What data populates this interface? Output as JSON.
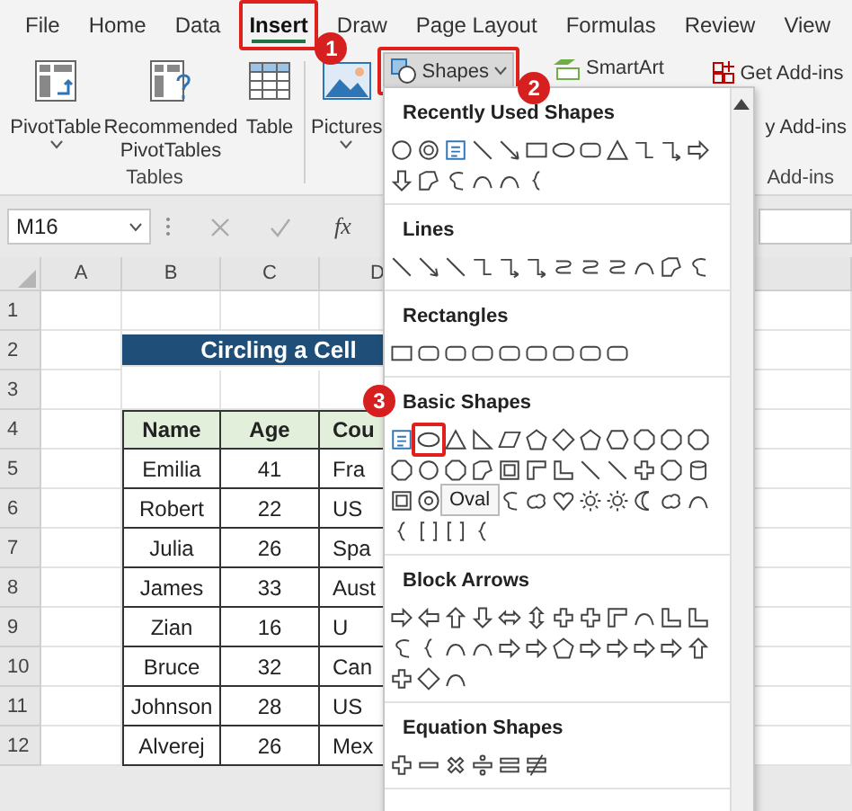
{
  "tabs": [
    {
      "label": "File",
      "selected": false
    },
    {
      "label": "Home",
      "selected": false
    },
    {
      "label": "Data",
      "selected": false
    },
    {
      "label": "Insert",
      "selected": true
    },
    {
      "label": "Draw",
      "selected": false
    },
    {
      "label": "Page Layout",
      "selected": false
    },
    {
      "label": "Formulas",
      "selected": false
    },
    {
      "label": "Review",
      "selected": false
    },
    {
      "label": "View",
      "selected": false
    }
  ],
  "ribbon": {
    "tables": {
      "buttons": [
        "PivotTable",
        "Recommended PivotTables",
        "Table"
      ],
      "label": "Tables"
    },
    "pictures": "Pictures",
    "shapes": {
      "label": "Shapes",
      "selected": true
    },
    "smartart": "SmartArt",
    "addins": {
      "buttons": [
        "Get Add-ins",
        "y Add-ins"
      ],
      "label": "Add-ins"
    }
  },
  "formula_bar": {
    "name_box": "M16",
    "function_button": "fx"
  },
  "sheet": {
    "columns": [
      "A",
      "B",
      "C",
      "D"
    ],
    "rows": [
      "1",
      "2",
      "3",
      "4",
      "5",
      "6",
      "7",
      "8",
      "9",
      "10",
      "11",
      "12"
    ],
    "title": "Circling a Cell",
    "table": {
      "columns": [
        "Name",
        "Age",
        "Cou"
      ],
      "rows": [
        [
          "Emilia",
          "41",
          "Fra"
        ],
        [
          "Robert",
          "22",
          "US"
        ],
        [
          "Julia",
          "26",
          "Spa"
        ],
        [
          "James",
          "33",
          "Aust"
        ],
        [
          "Zian",
          "16",
          "U"
        ],
        [
          "Bruce",
          "32",
          "Can"
        ],
        [
          "Johnson",
          "28",
          "US"
        ],
        [
          "Alverej",
          "26",
          "Mex"
        ]
      ]
    }
  },
  "shapes_menu": {
    "sections": [
      {
        "title": "Recently Used Shapes"
      },
      {
        "title": "Lines"
      },
      {
        "title": "Rectangles"
      },
      {
        "title": "Basic Shapes"
      },
      {
        "title": "Block Arrows"
      },
      {
        "title": "Equation Shapes"
      }
    ],
    "tooltip": "Oval"
  },
  "callouts": [
    {
      "label": "1"
    },
    {
      "label": "2"
    },
    {
      "label": "3"
    }
  ]
}
